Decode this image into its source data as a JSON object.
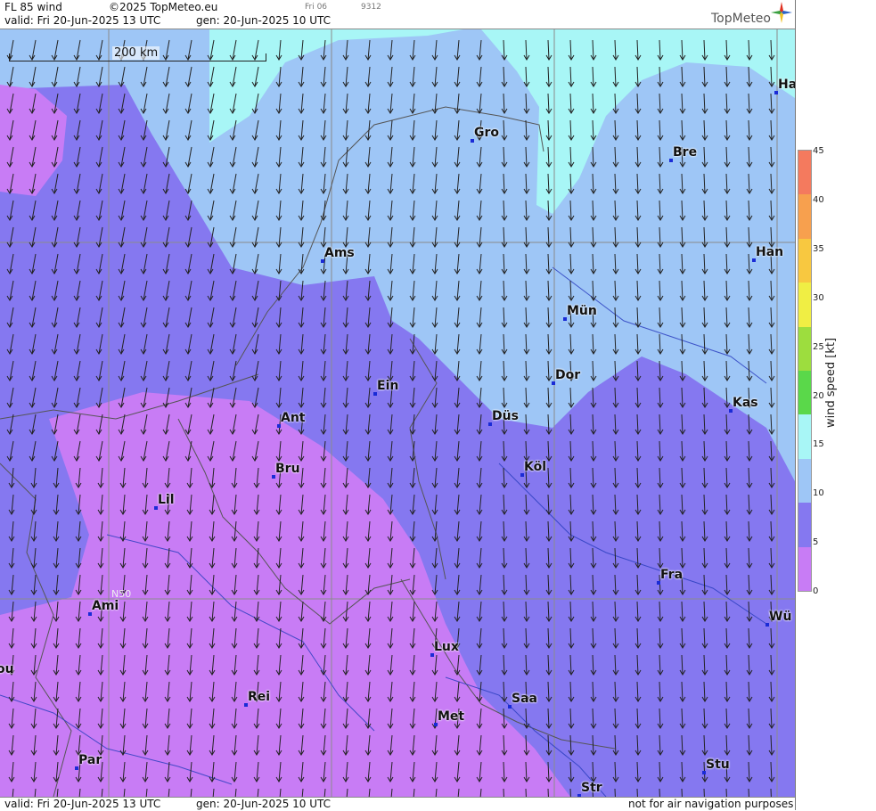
{
  "header": {
    "title": "FL 85 wind",
    "copyright": "©2025 TopMeteo.eu",
    "small_day": "Fri 06",
    "small_code": "9312",
    "valid": "valid:  Fri  20-Jun-2025  13 UTC",
    "gen": "gen: 20-Jun-2025 10 UTC",
    "logo": "TopMeteo"
  },
  "footer": {
    "valid": "valid:  Fri  20-Jun-2025  13 UTC",
    "gen": "gen: 20-Jun-2025 10 UTC",
    "disclaimer": "not for air navigation purposes"
  },
  "scale_bar": {
    "label": "200 km"
  },
  "grid_label": "N50",
  "legend": {
    "title": "wind  speed  [kt]",
    "ticks": [
      "45",
      "40",
      "35",
      "30",
      "25",
      "20",
      "15",
      "10",
      "5",
      "0"
    ],
    "colors": [
      "#f47a5e",
      "#f7a04e",
      "#f8c840",
      "#f0ee44",
      "#9ddd3e",
      "#5ad84a",
      "#a8f6f6",
      "#9ec6f6",
      "#8578f0",
      "#c87cf5"
    ]
  },
  "cities": [
    {
      "name": "Gro"
    },
    {
      "name": "Bre"
    },
    {
      "name": "Ha"
    },
    {
      "name": "Ams"
    },
    {
      "name": "Han"
    },
    {
      "name": "Mün"
    },
    {
      "name": "Dor"
    },
    {
      "name": "Ein"
    },
    {
      "name": "Kas"
    },
    {
      "name": "Ant"
    },
    {
      "name": "Düs"
    },
    {
      "name": "Bru"
    },
    {
      "name": "Köl"
    },
    {
      "name": "Lil"
    },
    {
      "name": "Fra"
    },
    {
      "name": "Ami"
    },
    {
      "name": "Wü"
    },
    {
      "name": "Lux"
    },
    {
      "name": "ou"
    },
    {
      "name": "Rei"
    },
    {
      "name": "Saa"
    },
    {
      "name": "Met"
    },
    {
      "name": "Par"
    },
    {
      "name": "Stu"
    },
    {
      "name": "Str"
    }
  ]
}
